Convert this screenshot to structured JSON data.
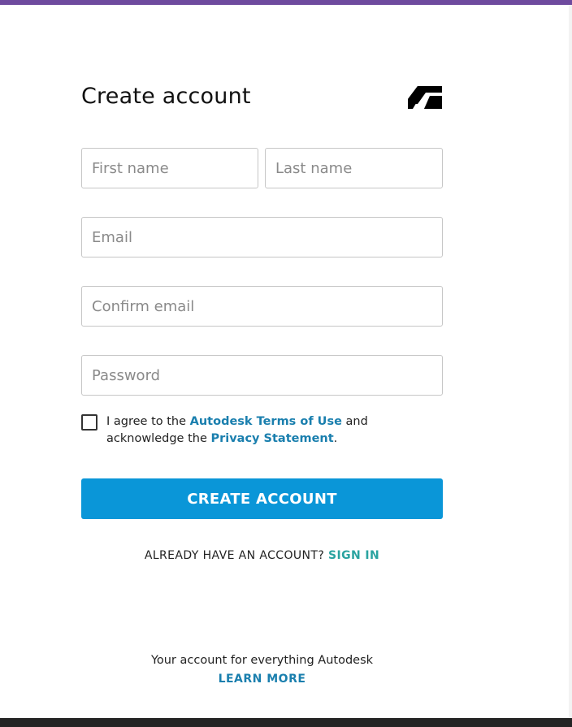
{
  "colors": {
    "top_bar": "#6e4a9e",
    "primary_button": "#0a96d8",
    "link": "#1a7fae",
    "sign_in_link": "#2aa3a0",
    "bottom_bar": "#242424"
  },
  "header": {
    "title": "Create account",
    "logo_icon": "autodesk-logo-icon"
  },
  "form": {
    "first_name": {
      "placeholder": "First name",
      "value": ""
    },
    "last_name": {
      "placeholder": "Last name",
      "value": ""
    },
    "email": {
      "placeholder": "Email",
      "value": ""
    },
    "confirm_email": {
      "placeholder": "Confirm email",
      "value": ""
    },
    "password": {
      "placeholder": "Password",
      "value": ""
    },
    "agreement": {
      "checked": false,
      "text_1": "I agree to the ",
      "terms_link": "Autodesk Terms of Use",
      "text_2": " and acknowledge the ",
      "privacy_link": "Privacy Statement",
      "text_3": "."
    },
    "submit_label": "CREATE ACCOUNT"
  },
  "signin": {
    "prompt": "ALREADY HAVE AN ACCOUNT? ",
    "link": "SIGN IN"
  },
  "footer": {
    "text": "Your account for everything Autodesk",
    "learn_more": "LEARN MORE"
  }
}
